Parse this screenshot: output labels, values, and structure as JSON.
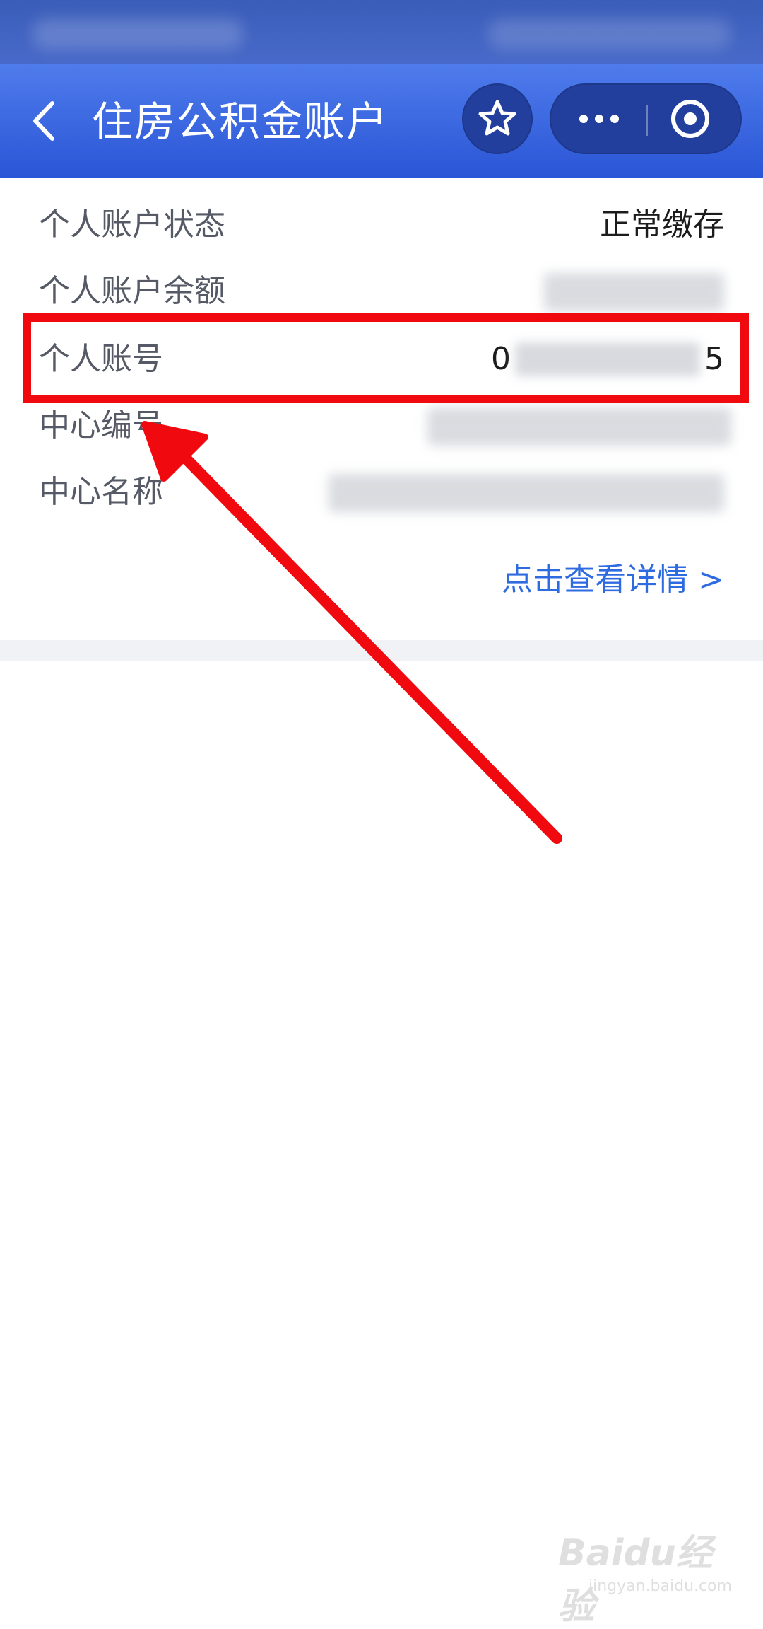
{
  "header": {
    "title": "住房公积金账户",
    "back_icon": "chevron-left-icon",
    "star_icon": "star-icon",
    "more_icon": "more-dots-icon",
    "close_icon": "target-close-icon"
  },
  "account": {
    "rows": [
      {
        "label": "个人账户状态",
        "value": "正常缴存"
      },
      {
        "label": "个人账户余额",
        "value": ""
      },
      {
        "label": "个人账号",
        "value_start": "0",
        "value_end": "5"
      },
      {
        "label": "中心编号",
        "value": ""
      },
      {
        "label": "中心名称",
        "value": ""
      }
    ],
    "details_link": "点击查看详情 >"
  },
  "annotation": {
    "highlight_color": "#f00a10",
    "arrow_color": "#f00a10"
  },
  "watermark": {
    "brand": "Baidu经验",
    "url": "jingyan.baidu.com"
  },
  "colors": {
    "header_top": "#4f7cec",
    "header_bottom": "#2a55d6",
    "link": "#2f6be0"
  }
}
